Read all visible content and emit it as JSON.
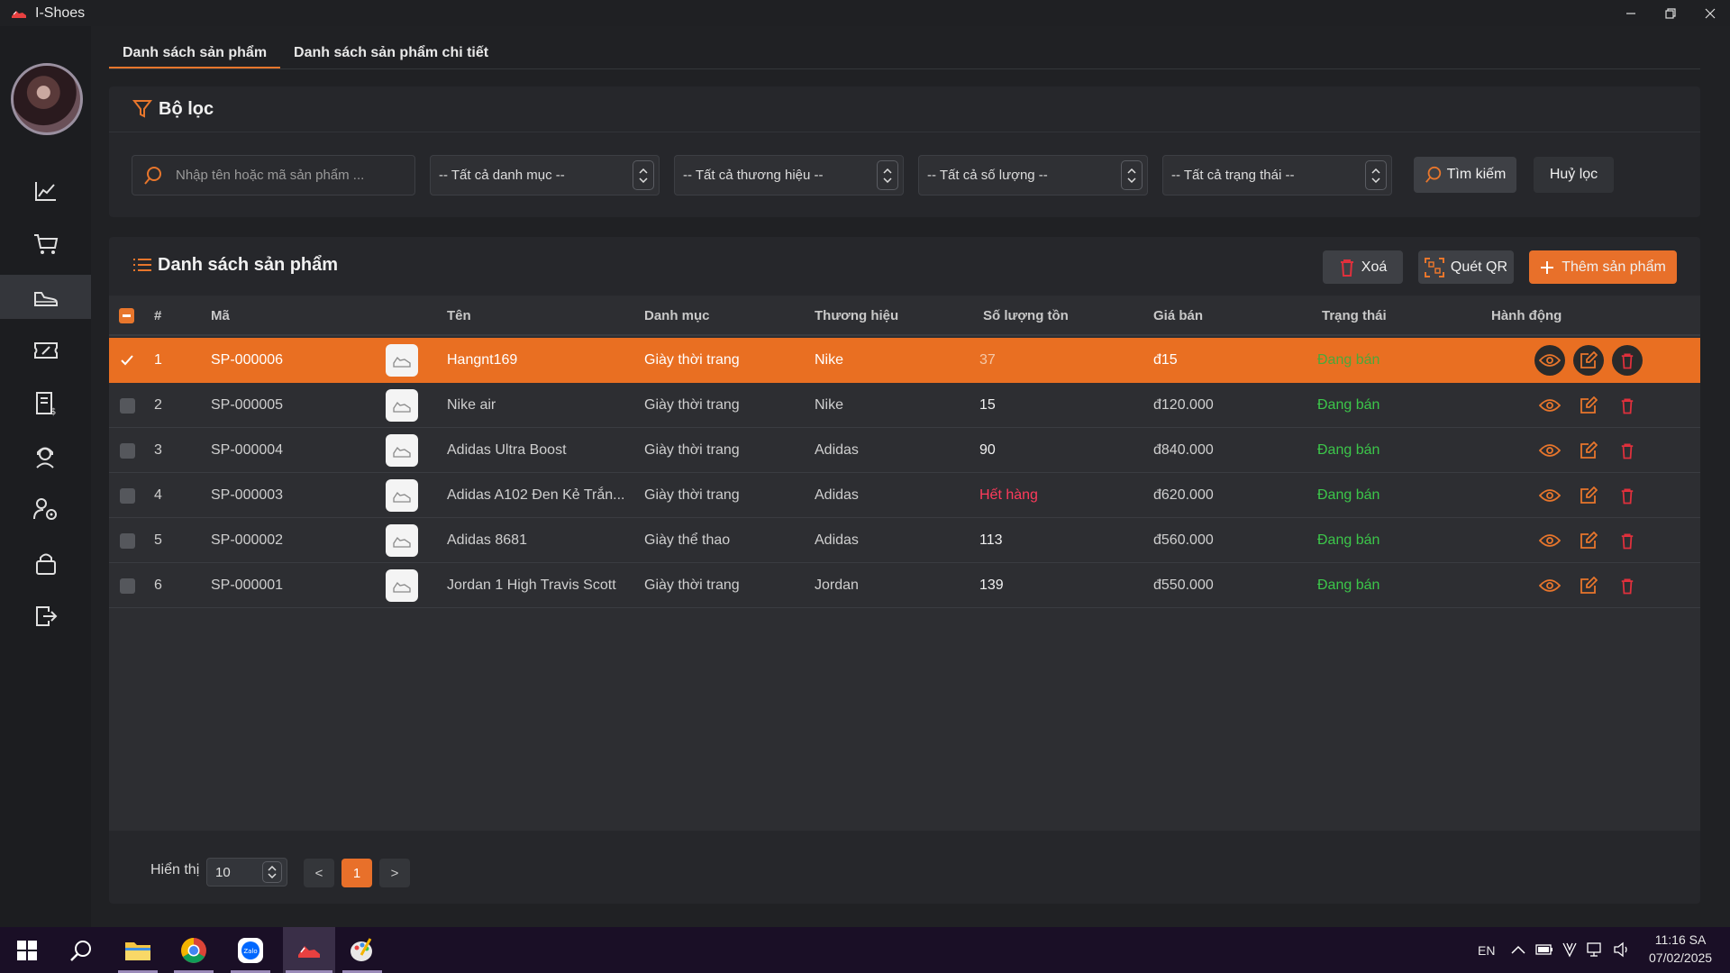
{
  "app": {
    "title": "I-Shoes"
  },
  "tabs": [
    {
      "label": "Danh sách sản phẩm"
    },
    {
      "label": "Danh sách sản phẩm chi tiết"
    }
  ],
  "sidebar": {
    "items": [
      {
        "icon": "chart-line-icon"
      },
      {
        "icon": "cart-icon"
      },
      {
        "icon": "shoe-icon",
        "active": true
      },
      {
        "icon": "voucher-icon"
      },
      {
        "icon": "invoice-icon"
      },
      {
        "icon": "customer-support-icon"
      },
      {
        "icon": "staff-settings-icon"
      },
      {
        "icon": "lock-icon"
      },
      {
        "icon": "logout-icon"
      }
    ]
  },
  "filter": {
    "title": "Bộ lọc",
    "search_placeholder": "Nhập tên hoặc mã sản phẩm ...",
    "category": "-- Tất cả danh mục --",
    "brand": "-- Tất cả thương hiệu --",
    "quantity": "-- Tất cả số lượng --",
    "status": "-- Tất cả trạng thái --",
    "search_button": "Tìm kiếm",
    "clear_button": "Huỷ lọc"
  },
  "list": {
    "title": "Danh sách sản phẩm",
    "delete_button": "Xoá",
    "qr_button": "Quét QR",
    "add_button": "Thêm sản phẩm",
    "columns": [
      "#",
      "Mã",
      "Tên",
      "Danh mục",
      "Thương hiệu",
      "Số lượng tồn",
      "Giá bán",
      "Trạng thái",
      "Hành động"
    ],
    "rows": [
      {
        "index": "1",
        "code": "SP-000006",
        "name": "Hangnt169",
        "category": "Giày thời trang",
        "brand": "Nike",
        "qty": "37",
        "price": "đ15",
        "status": "Đang bán",
        "selected": true
      },
      {
        "index": "2",
        "code": "SP-000005",
        "name": "Nike air",
        "category": "Giày thời trang",
        "brand": "Nike",
        "qty": "15",
        "price": "đ120.000",
        "status": "Đang bán"
      },
      {
        "index": "3",
        "code": "SP-000004",
        "name": "Adidas Ultra Boost",
        "category": "Giày thời trang",
        "brand": "Adidas",
        "qty": "90",
        "price": "đ840.000",
        "status": "Đang bán"
      },
      {
        "index": "4",
        "code": "SP-000003",
        "name": "Adidas A102 Đen Kẻ Trắn...",
        "category": "Giày thời trang",
        "brand": "Adidas",
        "qty": "Hết hàng",
        "price": "đ620.000",
        "status": "Đang bán",
        "out_of_stock": true
      },
      {
        "index": "5",
        "code": "SP-000002",
        "name": "Adidas 8681",
        "category": "Giày thể thao",
        "brand": "Adidas",
        "qty": "113",
        "price": "đ560.000",
        "status": "Đang bán"
      },
      {
        "index": "6",
        "code": "SP-000001",
        "name": "Jordan 1 High Travis Scott",
        "category": "Giày thời trang",
        "brand": "Jordan",
        "qty": "139",
        "price": "đ550.000",
        "status": "Đang bán"
      }
    ]
  },
  "pagination": {
    "label": "Hiển thị",
    "page_size": "10",
    "prev": "<",
    "current": "1",
    "next": ">"
  },
  "taskbar": {
    "language": "EN",
    "time": "11:16 SA",
    "date": "07/02/2025"
  },
  "colors": {
    "accent": "#e8702a",
    "status_green": "#3cc64a",
    "out_of_stock": "#ff3b5c",
    "delete_red": "#e0303c"
  }
}
